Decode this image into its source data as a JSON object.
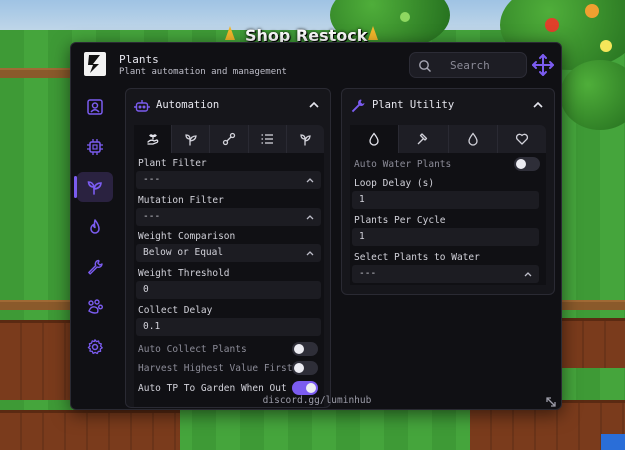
{
  "game": {
    "banner": "Shop Restock"
  },
  "header": {
    "title": "Plants",
    "subtitle": "Plant automation and management",
    "search_placeholder": "Search"
  },
  "colors": {
    "accent": "#7b5cf0",
    "window_bg": "#101014",
    "panel_bg": "#16161b"
  },
  "sidebar": {
    "active_index": 2,
    "items": [
      {
        "icon": "profile-icon"
      },
      {
        "icon": "chip-icon"
      },
      {
        "icon": "sprout-icon"
      },
      {
        "icon": "flame-icon"
      },
      {
        "icon": "wrench-icon"
      },
      {
        "icon": "paw-icon"
      },
      {
        "icon": "gear-icon"
      }
    ]
  },
  "automation": {
    "title": "Automation",
    "tabs": [
      "hand-seedling-icon",
      "sprout-icon",
      "link-icon",
      "list-icon",
      "sprout-icon"
    ],
    "fields": {
      "plant_filter": {
        "label": "Plant Filter",
        "value": "---"
      },
      "mutation_filter": {
        "label": "Mutation Filter",
        "value": "---"
      },
      "weight_comparison": {
        "label": "Weight Comparison",
        "value": "Below or Equal"
      },
      "weight_threshold": {
        "label": "Weight Threshold",
        "value": "0"
      },
      "collect_delay": {
        "label": "Collect Delay",
        "value": "0.1"
      }
    },
    "toggles": {
      "auto_collect": {
        "label": "Auto Collect Plants",
        "on": false
      },
      "harvest_highest": {
        "label": "Harvest Highest Value First",
        "on": false
      },
      "auto_tp": {
        "label": "Auto TP To Garden When Out",
        "on": true
      }
    }
  },
  "utility": {
    "title": "Plant Utility",
    "tabs": [
      "droplet-icon",
      "hammer-icon",
      "droplet-outline-icon",
      "heart-icon"
    ],
    "auto_water": {
      "label": "Auto Water Plants",
      "on": false
    },
    "loop_delay": {
      "label": "Loop Delay (s)",
      "value": "1"
    },
    "plants_per_cycle": {
      "label": "Plants Per Cycle",
      "value": "1"
    },
    "select_plants": {
      "label": "Select Plants to Water",
      "value": "---"
    }
  },
  "footer": {
    "text": "discord.gg/luminhub"
  }
}
